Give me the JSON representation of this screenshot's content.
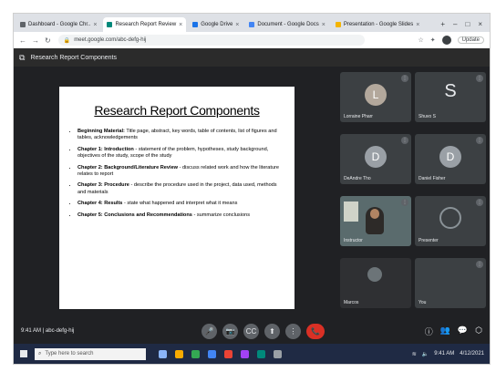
{
  "browser": {
    "tabs": [
      {
        "label": "Dashboard - Google Chr..",
        "active": false
      },
      {
        "label": "Research Report Review",
        "active": true
      },
      {
        "label": "Google Drive",
        "active": false
      },
      {
        "label": "Document - Google Docs",
        "active": false
      },
      {
        "label": "Presentation - Google Slides",
        "active": false
      }
    ],
    "url": "meet.google.com/abc-defg-hij",
    "update_label": "Update"
  },
  "meeting": {
    "header_title": "Research Report Components",
    "time_label": "9:41 AM | abc-defg-hij"
  },
  "slide": {
    "title": "Research Report Components",
    "bullets": [
      {
        "bold": "Beginning Material:",
        "text": " Title page, abstract, key words, table of contents, list of figures and tables, acknowledgements"
      },
      {
        "bold": "Chapter 1: Introduction",
        "text": " - statement of the problem, hypotheses, study background, objectives of the study, scope of the study"
      },
      {
        "bold": "Chapter 2: Background/Literature Review",
        "text": " - discuss related work and how the literature relates to report"
      },
      {
        "bold": "Chapter 3: Procedure",
        "text": " - describe the procedure used in the project, data used, methods and materials"
      },
      {
        "bold": "Chapter 4: Results",
        "text": " - state what happened and interpret what it means"
      },
      {
        "bold": "Chapter 5: Conclusions and Recommendations",
        "text": " - summarize conclusions"
      }
    ]
  },
  "participants": [
    {
      "type": "avatar",
      "initial": "L",
      "color": "#b3a89c",
      "name": "Lorraine Pharr"
    },
    {
      "type": "letter",
      "initial": "S",
      "name": "Shuvo S"
    },
    {
      "type": "avatar",
      "initial": "D",
      "color": "#9aa0a6",
      "name": "DeAndre Tho"
    },
    {
      "type": "avatar",
      "initial": "D",
      "color": "#9aa0a6",
      "name": "Daniel Fisher"
    },
    {
      "type": "camera",
      "name": "Instructor"
    },
    {
      "type": "phone",
      "name": "Presenter"
    },
    {
      "type": "dark",
      "name": "Marcos"
    },
    {
      "type": "empty",
      "name": "You"
    }
  ],
  "controls": {
    "mic": "🎤",
    "camera": "📷",
    "captions": "CC",
    "present": "⬆",
    "more": "⋮",
    "end": "📞"
  },
  "taskbar": {
    "search_placeholder": "Type here to search",
    "time": "9:41 AM",
    "date": "4/12/2021"
  },
  "colors": {
    "end_call": "#d93025",
    "meet_bg": "#202124",
    "tile_bg": "#3c4043"
  }
}
